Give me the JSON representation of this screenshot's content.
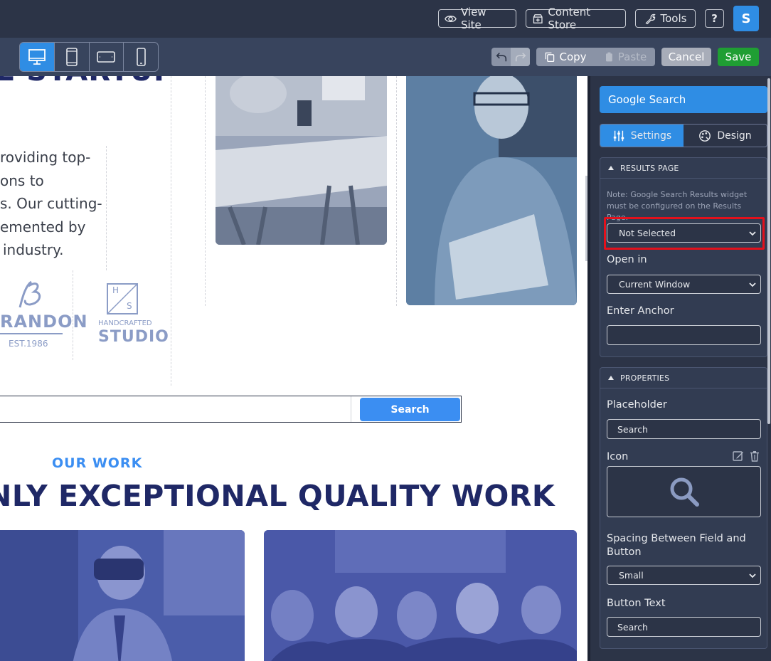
{
  "topbar": {
    "view_site": "View Site",
    "content_store": "Content Store",
    "tools": "Tools",
    "help": "?",
    "avatar_initial": "S"
  },
  "toolbar": {
    "devices": [
      "desktop-icon",
      "tablet-icon",
      "tablet-landscape-icon",
      "mobile-icon"
    ],
    "active_device": "desktop",
    "copy": "Copy",
    "paste": "Paste",
    "cancel": "Cancel",
    "save": "Save"
  },
  "canvas": {
    "heading_fragment": "E STARTUP",
    "intro_lines": [
      "roviding top-",
      "ons to",
      "s. Our cutting-",
      "emented by",
      "industry."
    ],
    "logo1": {
      "text": "RANDON",
      "sub": "EST.1986"
    },
    "logo2": {
      "monogram_h": "H",
      "monogram_s": "S",
      "text1": "HANDCRAFTED",
      "text2": "STUDIO"
    },
    "search_button": "Search",
    "our_work": "OUR WORK",
    "big_heading": "NLY EXCEPTIONAL QUALITY WORK"
  },
  "panel": {
    "widget_title": "Google Search",
    "tabs": [
      {
        "label": "Settings",
        "icon": "sliders-icon",
        "active": true
      },
      {
        "label": "Design",
        "icon": "palette-icon",
        "active": false
      }
    ],
    "results_section": {
      "header": "RESULTS PAGE",
      "note": "Note: Google Search Results widget must be configured on the Results Page.",
      "results_page_select": "Not Selected",
      "open_in_label": "Open in",
      "open_in_value": "Current Window",
      "anchor_label": "Enter Anchor",
      "anchor_value": ""
    },
    "properties_section": {
      "header": "PROPERTIES",
      "placeholder_label": "Placeholder",
      "placeholder_value": "Search",
      "icon_label": "Icon",
      "icon_name": "search-icon",
      "spacing_label": "Spacing Between Field and Button",
      "spacing_value": "Small",
      "button_text_label": "Button Text",
      "button_text_value": "Search"
    }
  },
  "colors": {
    "topbar": "#2c3447",
    "toolbar": "#38445d",
    "accent_blue": "#2f8de4",
    "save_green": "#1f9e33",
    "heading_navy": "#1f2866",
    "highlight_red": "#e3111c"
  }
}
